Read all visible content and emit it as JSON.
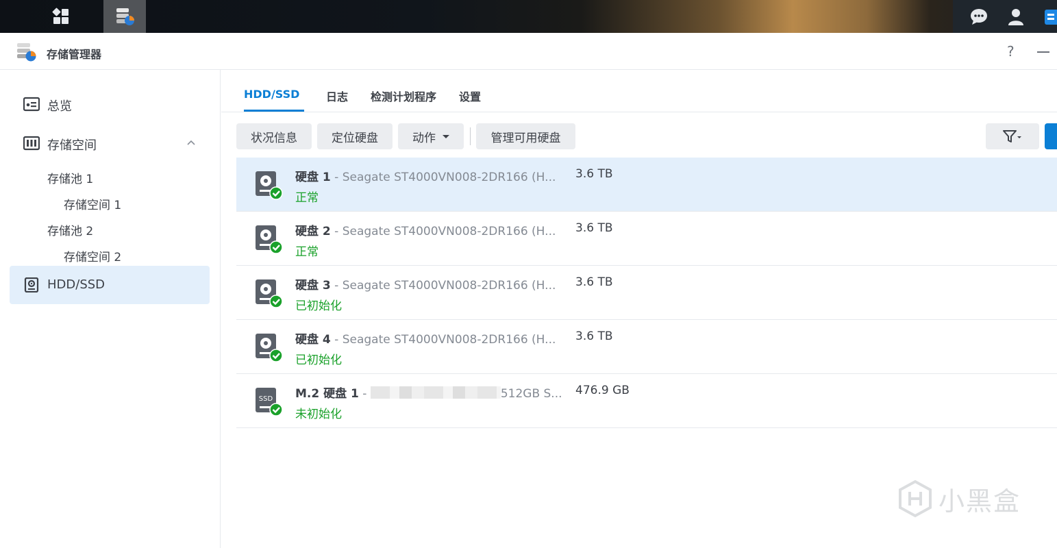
{
  "window": {
    "title": "存储管理器",
    "help_label": "?"
  },
  "sidebar": {
    "items": [
      {
        "label": "总览"
      },
      {
        "label": "存储空间"
      },
      {
        "label": "HDD/SSD"
      }
    ],
    "sub_items": [
      {
        "label": "存储池 1"
      },
      {
        "label": "存储空间 1"
      },
      {
        "label": "存储池 2"
      },
      {
        "label": "存储空间 2"
      }
    ]
  },
  "tabs": [
    {
      "label": "HDD/SSD"
    },
    {
      "label": "日志"
    },
    {
      "label": "检测计划程序"
    },
    {
      "label": "设置"
    }
  ],
  "toolbar": {
    "status_info": "状况信息",
    "locate_disk": "定位硬盘",
    "action": "动作",
    "manage_disks": "管理可用硬盘"
  },
  "disks": [
    {
      "name": "硬盘 1",
      "sep": " - ",
      "model": "Seagate ST4000VN008-2DR166 (H...",
      "size": "3.6 TB",
      "status": "正常",
      "type": "HDD"
    },
    {
      "name": "硬盘 2",
      "sep": " - ",
      "model": "Seagate ST4000VN008-2DR166 (H...",
      "size": "3.6 TB",
      "status": "正常",
      "type": "HDD"
    },
    {
      "name": "硬盘 3",
      "sep": " - ",
      "model": "Seagate ST4000VN008-2DR166 (H...",
      "size": "3.6 TB",
      "status": "已初始化",
      "type": "HDD"
    },
    {
      "name": "硬盘 4",
      "sep": " - ",
      "model": "Seagate ST4000VN008-2DR166 (H...",
      "size": "3.6 TB",
      "status": "已初始化",
      "type": "HDD"
    },
    {
      "name": "M.2 硬盘 1",
      "sep": " - ",
      "model": "512GB S...",
      "size": "476.9 GB",
      "status": "未初始化",
      "type": "SSD",
      "icon_text": "SSD"
    }
  ],
  "watermark": {
    "text": "小黑盒"
  },
  "colors": {
    "accent": "#0b7fd5",
    "status_ok": "#1aa12a",
    "selected_row": "#e3effb"
  }
}
